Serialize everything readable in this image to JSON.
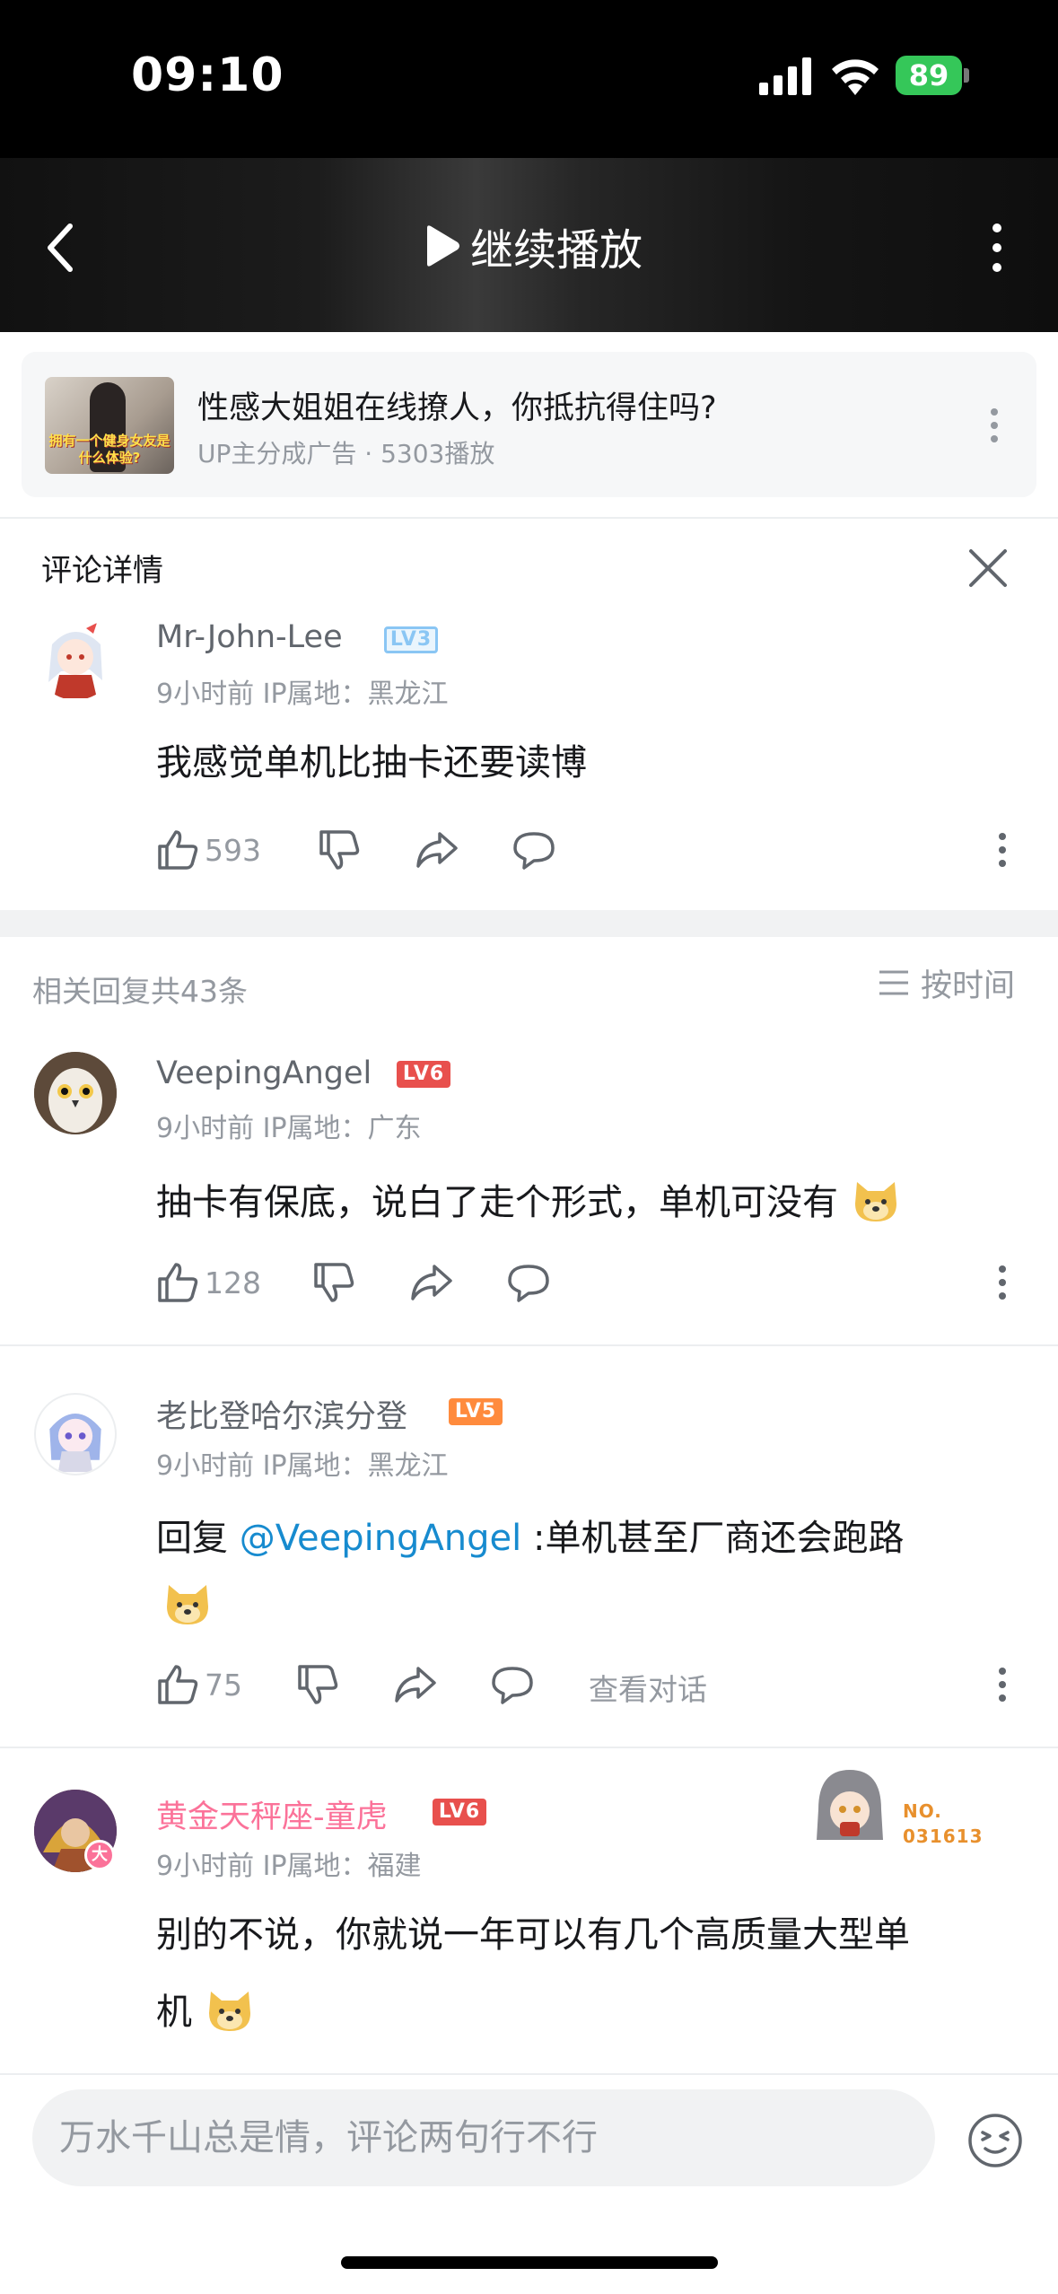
{
  "status_bar": {
    "time": "09:10",
    "battery": "89"
  },
  "video_bar": {
    "continue_label": "继续播放"
  },
  "ad": {
    "thumb_caption": "拥有一个健身女友是什么体验?",
    "title": "性感大姐姐在线撩人，你抵抗得住吗?",
    "subtitle": "UP主分成广告 · 5303播放"
  },
  "detail": {
    "title": "评论详情"
  },
  "main_comment": {
    "username": "Mr-John-Lee",
    "level": "LV3",
    "meta": "9小时前  IP属地：黑龙江",
    "text": "我感觉单机比抽卡还要读博",
    "likes": "593"
  },
  "replies_header": {
    "count_label": "相关回复共43条",
    "sort_label": "按时间"
  },
  "replies": [
    {
      "username": "VeepingAngel",
      "level": "LV6",
      "meta": "9小时前  IP属地：广东",
      "text": "抽卡有保底，说白了走个形式，单机可没有",
      "likes": "128"
    },
    {
      "username": "老比登哈尔滨分登",
      "level": "LV5",
      "meta": "9小时前  IP属地：黑龙江",
      "reply_prefix": "回复 ",
      "mention": "@VeepingAngel",
      "text": " :单机甚至厂商还会跑路",
      "likes": "75",
      "view_conversation": "查看对话"
    },
    {
      "username": "黄金天秤座-童虎",
      "level": "LV6",
      "meta": "9小时前  IP属地：福建",
      "text_line1": "别的不说，你就说一年可以有几个高质量大型单",
      "text_line2": "机",
      "badge_no_label": "NO.",
      "badge_no_value": "031613"
    }
  ],
  "input": {
    "placeholder": "万水千山总是情，评论两句行不行"
  },
  "colors": {
    "lv3": "#8ac6f4",
    "lv5": "#ff8b3d",
    "lv6": "#e8504d",
    "vip_name": "#fb7299",
    "mention": "#178bcf"
  }
}
